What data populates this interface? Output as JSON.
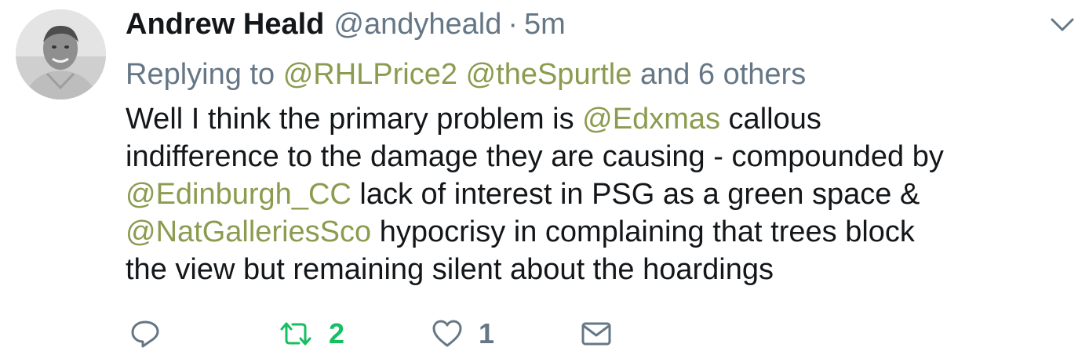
{
  "author": {
    "display_name": "Andrew Heald",
    "handle": "@andyheald",
    "separator": "·",
    "time": "5m"
  },
  "replying": {
    "prefix": "Replying to",
    "mention_1": "@RHLPrice2",
    "mention_2": "@theSpurtle",
    "suffix": "and 6 others"
  },
  "tweet": {
    "line1_pre": "Well I think the primary problem is ",
    "mention_edxmas": "@Edxmas",
    "line1_post": " callous",
    "line2": "indifference to the damage they are causing - compounded by",
    "mention_edinburgh": "@Edinburgh_CC",
    "line3_post": " lack of interest in PSG as a green space &",
    "mention_natgalleries": "@NatGalleriesSco",
    "line4_post": " hypocrisy in complaining that trees block",
    "line5": "the view but remaining silent about the hoardings"
  },
  "actions": {
    "reply_icon": "reply-icon",
    "retweet_icon": "retweet-icon",
    "retweet_count": "2",
    "like_icon": "heart-icon",
    "like_count": "1",
    "dm_icon": "envelope-icon"
  },
  "colors": {
    "mention": "#8b9b4f",
    "secondary_text": "#657786",
    "retweet_green": "#17bf63"
  }
}
